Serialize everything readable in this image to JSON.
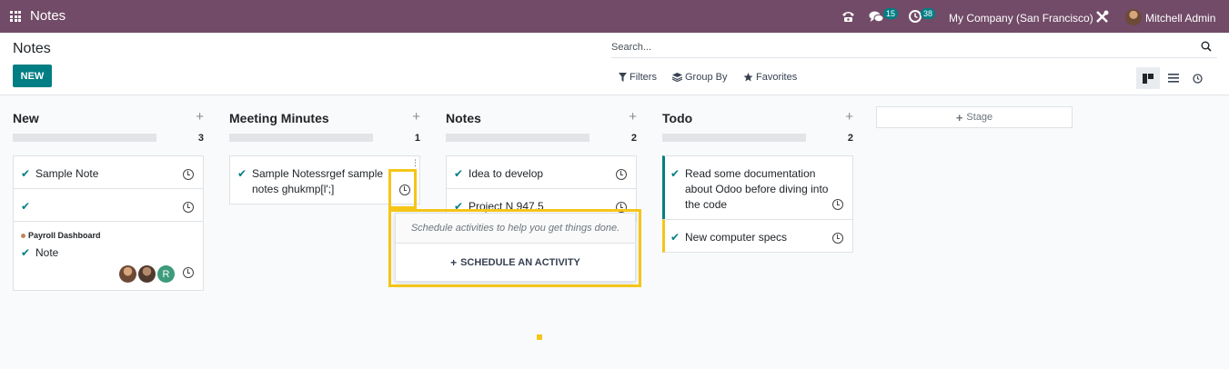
{
  "navbar": {
    "app_name": "Notes",
    "messages_count": "15",
    "activities_count": "38",
    "company": "My Company (San Francisco)",
    "user": "Mitchell Admin",
    "bg_color": "#714b67"
  },
  "control": {
    "breadcrumb": "Notes",
    "new_label": "NEW",
    "search_placeholder": "Search...",
    "filters_label": "Filters",
    "group_by_label": "Group By",
    "favorites_label": "Favorites"
  },
  "columns": [
    {
      "title": "New",
      "count": "3",
      "cards": [
        {
          "text": "Sample Note"
        },
        {
          "text": ""
        },
        {
          "tag": "Payroll Dashboard",
          "text": "Note",
          "assignees": [
            "avatar",
            "avatar",
            "R"
          ]
        }
      ]
    },
    {
      "title": "Meeting Minutes",
      "count": "1",
      "cards": [
        {
          "text": "Sample Notessrgef sample notes ghukmp[l';]"
        }
      ]
    },
    {
      "title": "Notes",
      "count": "2",
      "cards": [
        {
          "text": "Idea to develop"
        },
        {
          "text": "Project N 947.5"
        }
      ]
    },
    {
      "title": "Todo",
      "count": "2",
      "cards": [
        {
          "text": "Read some documentation about Odoo before diving into the code",
          "color": "#017e84"
        },
        {
          "text": "New computer specs",
          "color": "#f5c518"
        }
      ]
    }
  ],
  "add_stage_label": "Stage",
  "popover": {
    "hint": "Schedule activities to help you get things done.",
    "action": "SCHEDULE AN ACTIVITY"
  },
  "colors": {
    "accent": "#017e84",
    "highlight": "#f5c518",
    "primary": "#714b67"
  }
}
